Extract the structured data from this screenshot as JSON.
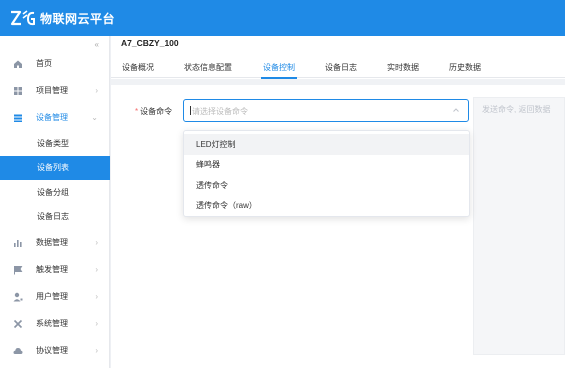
{
  "app": {
    "brand": "物联网云平台",
    "logo_icon": "zlg-logo",
    "accent_color": "#1f8ae6"
  },
  "sidebar": {
    "collapse_glyph": "«",
    "items": [
      {
        "label": "首页",
        "icon": "home-icon",
        "has_arrow": false
      },
      {
        "label": "项目管理",
        "icon": "grid-icon",
        "has_arrow": true
      },
      {
        "label": "设备管理",
        "icon": "device-icon",
        "has_arrow": true,
        "expanded": true
      },
      {
        "label": "数据管理",
        "icon": "bar-chart-icon",
        "has_arrow": true
      },
      {
        "label": "触发管理",
        "icon": "flag-icon",
        "has_arrow": true
      },
      {
        "label": "用户管理",
        "icon": "user-icon",
        "has_arrow": true
      },
      {
        "label": "系统管理",
        "icon": "tools-icon",
        "has_arrow": true
      },
      {
        "label": "协议管理",
        "icon": "cloud-icon",
        "has_arrow": true
      }
    ],
    "device_sub": [
      {
        "label": "设备类型",
        "selected": false
      },
      {
        "label": "设备列表",
        "selected": true
      },
      {
        "label": "设备分组",
        "selected": false
      },
      {
        "label": "设备日志",
        "selected": false
      }
    ]
  },
  "main": {
    "device_title": "A7_CBZY_100",
    "tabs": [
      {
        "label": "设备概况",
        "active": false
      },
      {
        "label": "状态信息配置",
        "active": false
      },
      {
        "label": "设备控制",
        "active": true
      },
      {
        "label": "设备日志",
        "active": false
      },
      {
        "label": "实时数据",
        "active": false
      },
      {
        "label": "历史数据",
        "active": false
      }
    ],
    "command": {
      "required_mark": "*",
      "label": "设备命令",
      "placeholder": "请选择设备命令",
      "response_placeholder": "发送命令, 返回数据"
    },
    "dropdown_options": [
      {
        "label": "LED灯控制",
        "hover": true
      },
      {
        "label": "蜂鸣器",
        "hover": false
      },
      {
        "label": "透传命令",
        "hover": false
      },
      {
        "label": "透传命令（raw）",
        "hover": false
      }
    ]
  }
}
